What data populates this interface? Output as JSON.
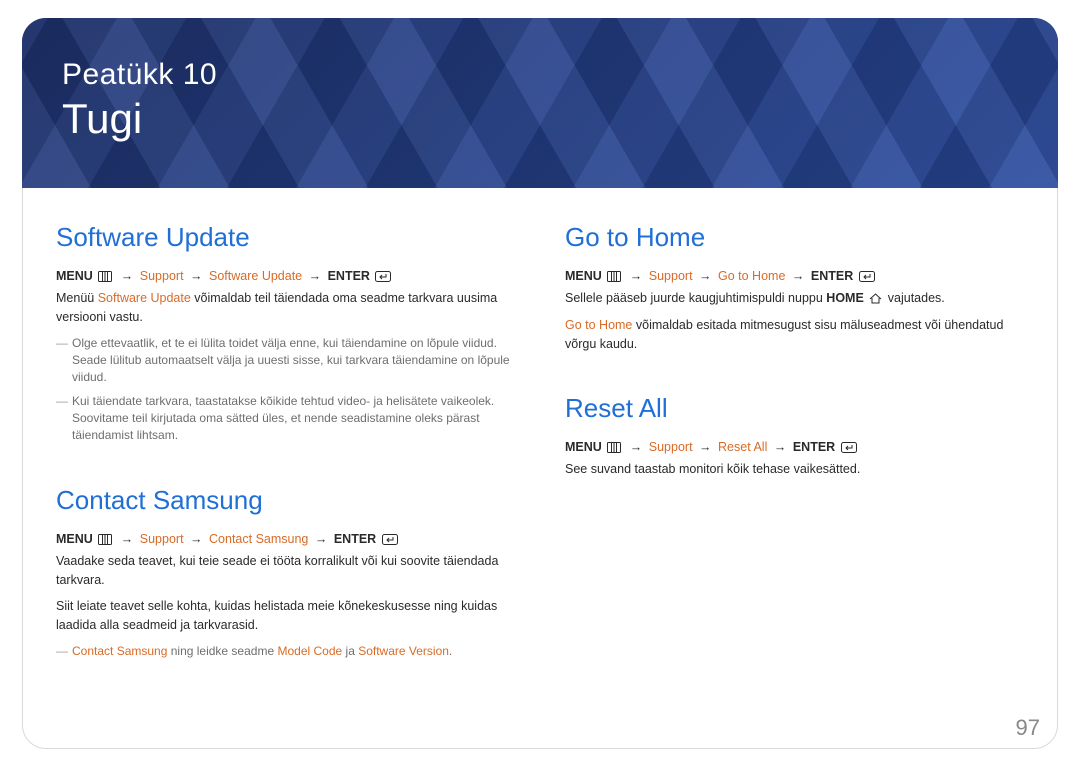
{
  "hero": {
    "line1": "Peatükk 10",
    "line2": "Tugi"
  },
  "left": {
    "swUpdate": {
      "title": "Software Update",
      "menu": {
        "prefix": "MENU",
        "support": "Support",
        "item": "Software Update",
        "enter": "ENTER"
      },
      "intro1a": "Menüü ",
      "intro1b": "Software Update",
      "intro1c": " võimaldab teil täiendada oma seadme tarkvara uusima versiooni vastu.",
      "bullets": [
        "Olge ettevaatlik, et te ei lülita toidet välja enne, kui täiendamine on lõpule viidud. Seade lülitub automaatselt välja ja uuesti sisse, kui tarkvara täiendamine on lõpule viidud.",
        "Kui täiendate tarkvara, taastatakse kõikide tehtud video- ja helisätete vaikeolek. Soovitame teil kirjutada oma sätted üles, et nende seadistamine oleks pärast täiendamist lihtsam."
      ]
    },
    "contact": {
      "title": "Contact Samsung",
      "menu": {
        "prefix": "MENU",
        "support": "Support",
        "item": "Contact Samsung",
        "enter": "ENTER"
      },
      "p1": "Vaadake seda teavet, kui teie seade ei tööta korralikult või kui soovite täiendada tarkvara.",
      "p2": "Siit leiate teavet selle kohta, kuidas helistada meie kõnekeskusesse ning kuidas laadida alla seadmeid ja tarkvarasid.",
      "note_a": "Contact Samsung",
      "note_b": " ning leidke seadme ",
      "note_c": "Model Code",
      "note_d": " ja ",
      "note_e": "Software Version",
      "note_f": "."
    }
  },
  "right": {
    "goHome": {
      "title": "Go to Home",
      "menu": {
        "prefix": "MENU",
        "support": "Support",
        "item": "Go to Home",
        "enter": "ENTER"
      },
      "p1a": "Sellele pääseb juurde kaugjuhtimispuldi nuppu ",
      "p1b": "HOME",
      "p1c": " vajutades.",
      "p2a": "Go to Home",
      "p2b": " võimaldab esitada mitmesugust sisu mäluseadmest või ühendatud võrgu kaudu."
    },
    "resetAll": {
      "title": "Reset All",
      "menu": {
        "prefix": "MENU",
        "support": "Support",
        "item": "Reset All",
        "enter": "ENTER"
      },
      "p1": "See suvand taastab monitori kõik tehase vaikesätted."
    }
  },
  "pageNumber": "97"
}
